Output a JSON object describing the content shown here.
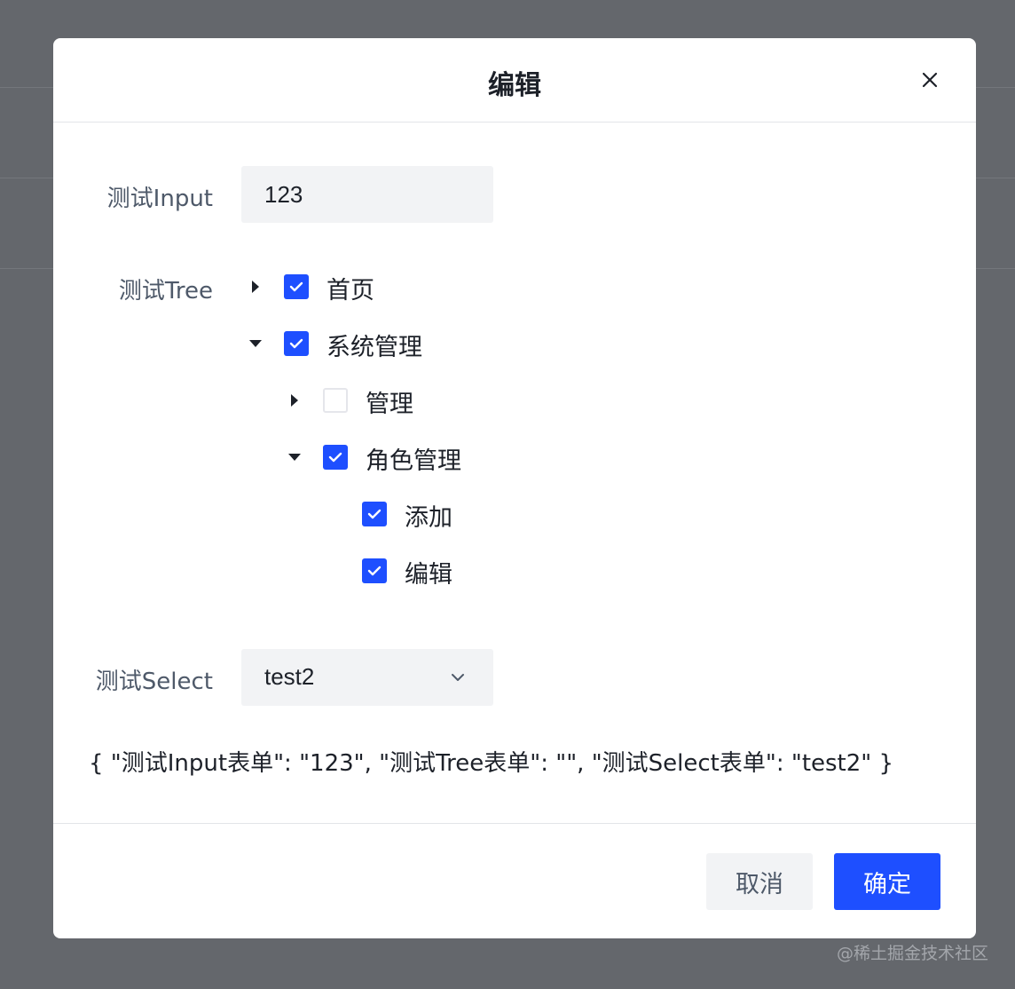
{
  "modal": {
    "title": "编辑"
  },
  "form": {
    "input": {
      "label": "测试Input",
      "value": "123"
    },
    "tree": {
      "label": "测试Tree",
      "nodes": [
        {
          "title": "首页",
          "checked": true,
          "expanded": false,
          "depth": 0,
          "has_children": true
        },
        {
          "title": "系统管理",
          "checked": true,
          "expanded": true,
          "depth": 0,
          "has_children": true
        },
        {
          "title": "管理",
          "checked": false,
          "expanded": false,
          "depth": 1,
          "has_children": true
        },
        {
          "title": "角色管理",
          "checked": true,
          "expanded": true,
          "depth": 1,
          "has_children": true
        },
        {
          "title": "添加",
          "checked": true,
          "depth": 2,
          "has_children": false
        },
        {
          "title": "编辑",
          "checked": true,
          "depth": 2,
          "has_children": false
        }
      ]
    },
    "select": {
      "label": "测试Select",
      "value": "test2"
    }
  },
  "json_output": "{ \"测试Input表单\": \"123\", \"测试Tree表单\": \"\", \"测试Select表单\": \"test2\" }",
  "footer": {
    "cancel_label": "取消",
    "ok_label": "确定"
  },
  "watermark": "@稀土掘金技术社区",
  "colors": {
    "primary": "#1e4fff",
    "overlay": "#64676c",
    "input_bg": "#f2f3f5",
    "text": "#1d2129",
    "label": "#4e5969"
  },
  "icons": {
    "close": "close-icon",
    "collapsed": "caret-right-icon",
    "expanded": "caret-down-icon",
    "check": "check-icon",
    "select_arrow": "chevron-down-icon"
  }
}
